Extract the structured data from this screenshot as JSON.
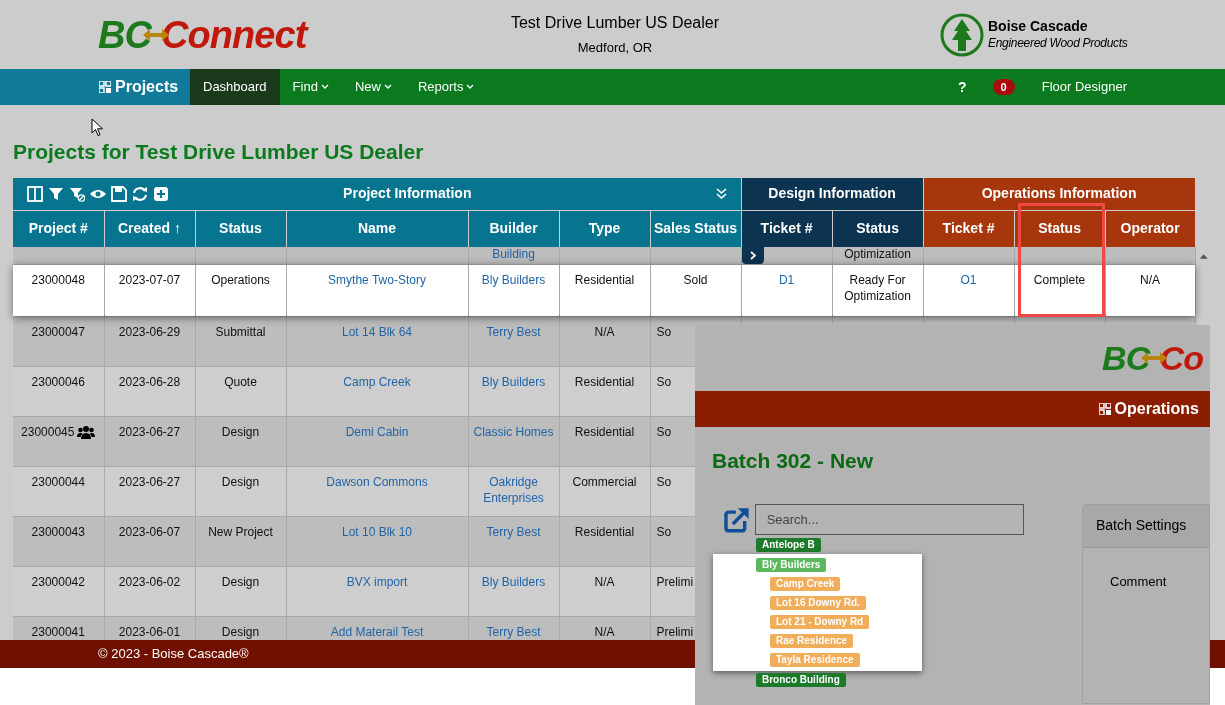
{
  "header": {
    "logo_left": "BC",
    "logo_right": "Connect",
    "dealer": "Test Drive Lumber US Dealer",
    "location": "Medford, OR",
    "brand_name": "Boise Cascade",
    "brand_tagline": "Engineered Wood Products"
  },
  "nav": {
    "section": "Projects",
    "items": [
      {
        "label": "Dashboard",
        "selected": true,
        "dropdown": false
      },
      {
        "label": "Find",
        "selected": false,
        "dropdown": true
      },
      {
        "label": "New",
        "selected": false,
        "dropdown": true
      },
      {
        "label": "Reports",
        "selected": false,
        "dropdown": true
      }
    ],
    "help": "?",
    "badge": "0",
    "user": "Floor Designer"
  },
  "page_title": "Projects for Test Drive Lumber US Dealer",
  "table": {
    "groups": [
      {
        "label": "Project Information",
        "kind": "project",
        "columns": [
          {
            "label": "Project #",
            "kind": "text",
            "outlined": false
          },
          {
            "label": "Created ↑",
            "kind": "text",
            "outlined": false
          },
          {
            "label": "Status",
            "kind": "text",
            "outlined": false
          },
          {
            "label": "Name",
            "kind": "link",
            "outlined": false
          },
          {
            "label": "Builder",
            "kind": "link",
            "outlined": false
          },
          {
            "label": "Type",
            "kind": "text",
            "outlined": false
          },
          {
            "label": "Sales Status",
            "kind": "text",
            "outlined": false
          }
        ]
      },
      {
        "label": "Design Information",
        "kind": "design",
        "columns": [
          {
            "label": "Ticket #",
            "kind": "link",
            "outlined": false
          },
          {
            "label": "Status",
            "kind": "text",
            "outlined": false
          }
        ]
      },
      {
        "label": "Operations Information",
        "kind": "operations",
        "columns": [
          {
            "label": "Ticket #",
            "kind": "link",
            "outlined": false
          },
          {
            "label": "Status",
            "kind": "text",
            "outlined": true
          },
          {
            "label": "Operator",
            "kind": "text",
            "outlined": false
          }
        ]
      }
    ],
    "rows": [
      {
        "kind": "partial",
        "selected": false,
        "shared": false,
        "cells": [
          "",
          "",
          "",
          "",
          "Building",
          "",
          "",
          "",
          "Optimization",
          "",
          "",
          ""
        ]
      },
      {
        "kind": "full",
        "selected": true,
        "shared": false,
        "cells": [
          "23000048",
          "2023-07-07",
          "Operations",
          "Smythe Two-Story",
          "Bly Builders",
          "Residential",
          "Sold",
          "D1",
          "Ready For Optimization",
          "O1",
          "Complete",
          "N/A"
        ]
      },
      {
        "kind": "covered",
        "selected": false,
        "shared": false,
        "cells": [
          "23000047",
          "2023-06-29",
          "Submittal",
          "Lot 14 Blk 64",
          "Terry Best",
          "N/A",
          "So"
        ]
      },
      {
        "kind": "covered",
        "selected": false,
        "shared": false,
        "cells": [
          "23000046",
          "2023-06-28",
          "Quote",
          "Camp Creek",
          "Bly Builders",
          "Residential",
          "So"
        ]
      },
      {
        "kind": "covered",
        "selected": false,
        "shared": true,
        "cells": [
          "23000045",
          "2023-06-27",
          "Design",
          "Demi Cabin",
          "Classic Homes",
          "Residential",
          "So"
        ]
      },
      {
        "kind": "covered",
        "selected": false,
        "shared": false,
        "cells": [
          "23000044",
          "2023-06-27",
          "Design",
          "Dawson Commons",
          "Oakridge Enterprises",
          "Commercial",
          "So"
        ]
      },
      {
        "kind": "covered",
        "selected": false,
        "shared": false,
        "cells": [
          "23000043",
          "2023-06-07",
          "New Project",
          "Lot 10 Blk 10",
          "Terry Best",
          "Residential",
          "So"
        ]
      },
      {
        "kind": "covered",
        "selected": false,
        "shared": false,
        "cells": [
          "23000042",
          "2023-06-02",
          "Design",
          "BVX import",
          "Bly Builders",
          "N/A",
          "Prelimi"
        ]
      },
      {
        "kind": "covered",
        "selected": false,
        "shared": false,
        "cells": [
          "23000041",
          "2023-06-01",
          "Design",
          "Add Materail Test",
          "Terry Best",
          "N/A",
          "Prelimi"
        ]
      }
    ]
  },
  "footer": "© 2023 - Boise Cascade®",
  "inset": {
    "logo_left": "BC",
    "logo_right": "Co",
    "section": "Operations",
    "title": "Batch 302 - New",
    "search": {
      "placeholder": "Search..."
    },
    "tree": [
      {
        "label": "Antelope B",
        "selected": false
      },
      {
        "label": "Bly Builders",
        "selected": true,
        "children": [
          {
            "label": "Camp Creek"
          },
          {
            "label": "Lot 16 Downy Rd."
          },
          {
            "label": "Lot 21 - Downy Rd"
          },
          {
            "label": "Rae Residence"
          },
          {
            "label": "Tayla Residence"
          }
        ]
      },
      {
        "label": "Bronco Building",
        "selected": false
      }
    ],
    "panel": {
      "title": "Batch Settings",
      "field": "Comment"
    }
  }
}
